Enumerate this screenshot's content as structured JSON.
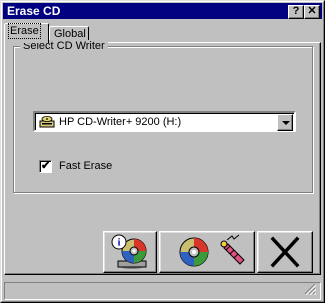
{
  "window": {
    "title": "Erase CD",
    "help_glyph": "?",
    "close_glyph": "✕"
  },
  "tabs": [
    {
      "label": "Erase",
      "active": true
    },
    {
      "label": "Global",
      "active": false
    }
  ],
  "group": {
    "label": "Select CD Writer",
    "writer_select": {
      "selected": "HP CD-Writer+ 9200 (H:)",
      "icon": "cd-drive-icon"
    },
    "fast_erase": {
      "label": "Fast Erase",
      "checked": true,
      "check_glyph": "✔"
    }
  },
  "buttons": [
    {
      "name": "disc-info-button",
      "icon": "disc-info-icon"
    },
    {
      "name": "erase-disc-button",
      "icon": "disc-erase-icon"
    },
    {
      "name": "cancel-button",
      "icon": "x-icon"
    }
  ]
}
